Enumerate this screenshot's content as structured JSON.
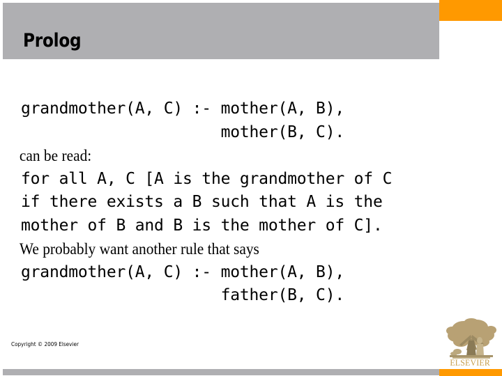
{
  "slide": {
    "title": "Prolog",
    "theme": {
      "accent_orange": "#FF9900",
      "band_gray": "#AFAFB2",
      "text_black": "#000000",
      "logo_gold": "#C8A050"
    }
  },
  "body": {
    "lines": [
      {
        "style": "code",
        "text": "grandmother(A, C) :- mother(A, B),"
      },
      {
        "style": "code",
        "text": "                     mother(B, C)."
      },
      {
        "style": "prose",
        "text": "can be read:"
      },
      {
        "style": "code",
        "text": "for all A, C [A is the grandmother of C"
      },
      {
        "style": "code",
        "text": "if there exists a B such that A is the"
      },
      {
        "style": "code",
        "text": "mother of B and B is the mother of C]."
      },
      {
        "style": "prose",
        "text": "We probably want another rule that says"
      },
      {
        "style": "code",
        "text": "grandmother(A, C) :- mother(A, B),"
      },
      {
        "style": "code",
        "text": "                     father(B, C)."
      }
    ]
  },
  "footer": {
    "copyright": "Copyright © 2009 Elsevier",
    "logo_wordmark": "ELSEVIER",
    "logo_name": "elsevier-tree-logo"
  }
}
